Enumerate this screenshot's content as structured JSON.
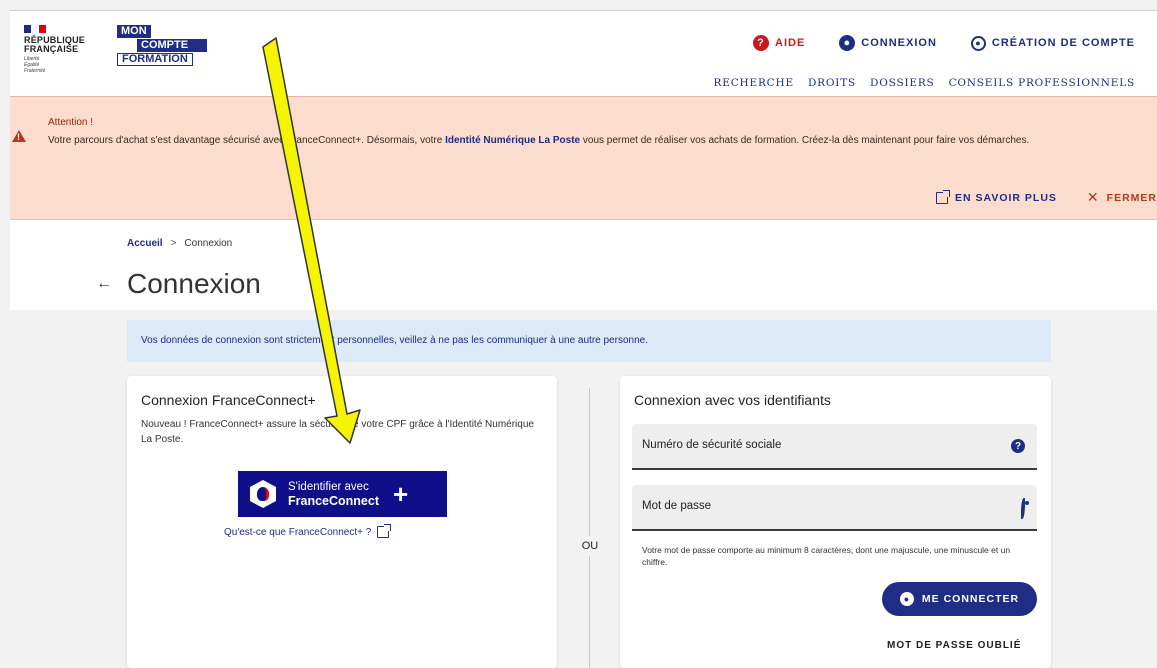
{
  "header": {
    "republique_line1": "RÉPUBLIQUE",
    "republique_line2": "FRANÇAISE",
    "motto": "Liberté Égalité Fraternité",
    "brand_line1": "MON",
    "brand_line2": "COMPTE",
    "brand_line3": "FORMATION",
    "top_links": {
      "aide": "AIDE",
      "connexion": "CONNEXION",
      "creation": "CRÉATION DE COMPTE"
    },
    "nav": [
      "RECHERCHE",
      "DROITS",
      "DOSSIERS",
      "CONSEILS PROFESSIONNELS"
    ]
  },
  "notice": {
    "title": "Attention !",
    "text_before": "Votre parcours d'achat s'est davantage sécurisé avec FranceConnect+. Désormais, votre ",
    "link_text": "Identité Numérique La Poste",
    "text_after": " vous permet de réaliser vos achats de formation. Créez-la dès maintenant pour faire vos démarches.",
    "learn_more": "EN SAVOIR PLUS",
    "close": "FERMER"
  },
  "breadcrumb": {
    "home": "Accueil",
    "separator": ">",
    "current": "Connexion"
  },
  "page_title": "Connexion",
  "info_banner": "Vos données de connexion sont strictement personnelles, veillez à ne pas les communiquer à une autre personne.",
  "franceconnect_card": {
    "title": "Connexion FranceConnect+",
    "description": "Nouveau ! FranceConnect+ assure la sécurité de votre CPF grâce à l'Identité Numérique La Poste.",
    "button_line1": "S'identifier avec",
    "button_line2": "FranceConnect",
    "button_plus": "+",
    "info_link": "Qu'est-ce que FranceConnect+ ?"
  },
  "or_label": "OU",
  "credentials_card": {
    "title": "Connexion avec vos identifiants",
    "ssn_placeholder": "Numéro de sécurité sociale",
    "password_placeholder": "Mot de passe",
    "password_hint": "Votre mot de passe comporte au minimum 8 caractères, dont une majuscule, une minuscule et un chiffre.",
    "connect_button": "ME CONNECTER",
    "forgot_password": "MOT DE PASSE OUBLIÉ"
  },
  "colors": {
    "brand_blue": "#1f2d84",
    "alert_red": "#c9191e",
    "notice_bg": "#fcdccc",
    "info_bg": "#dbeaf6",
    "franceconnect_blue": "#0f0f8a",
    "annotation_arrow": "#f5f500"
  }
}
